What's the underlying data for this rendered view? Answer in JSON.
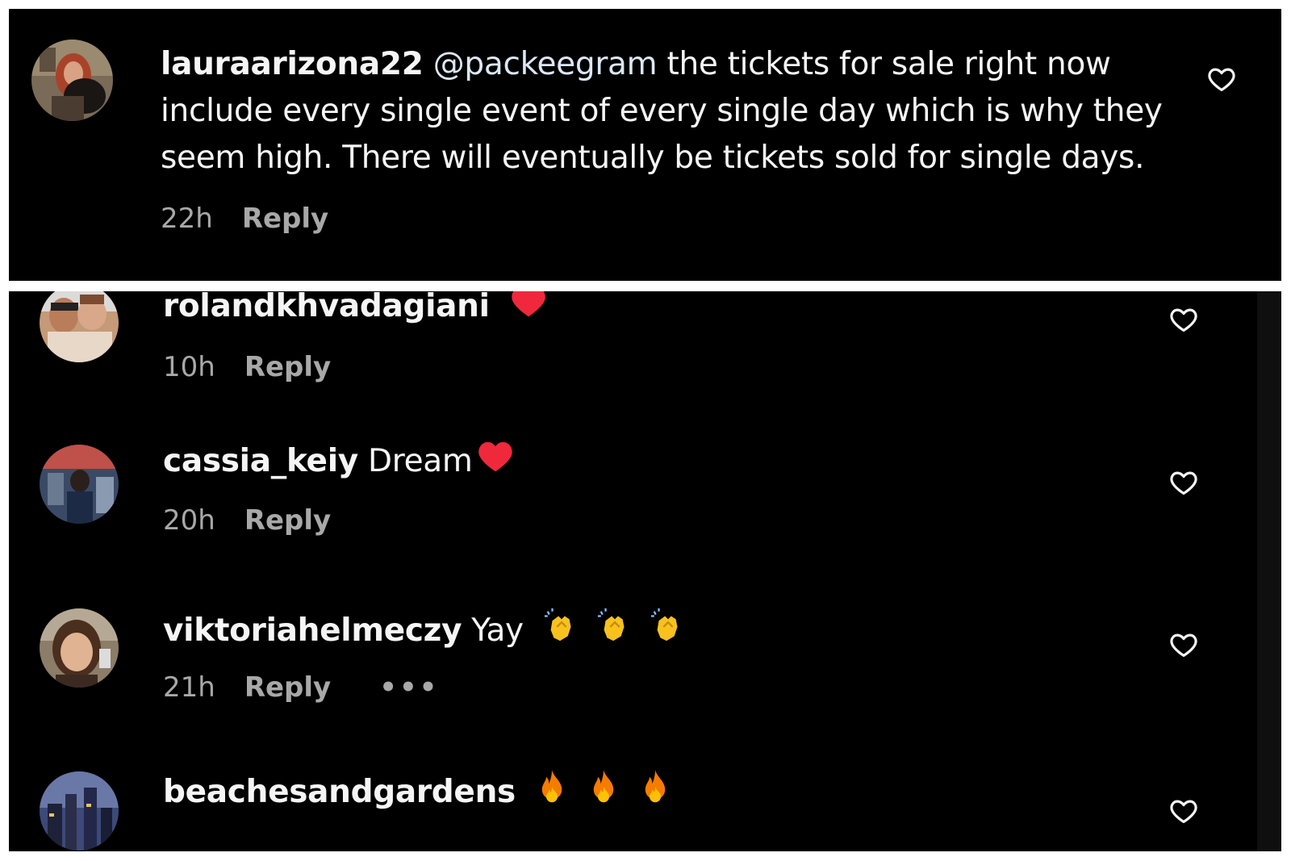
{
  "comments_top": [
    {
      "username": "lauraarizona22",
      "mention": "@packeegram",
      "text_line1": " the tickets for sale right now",
      "text_line2": "include every single event of every single day which is why they",
      "text_line3": "seem high. There will eventually be tickets sold for single days.",
      "time": "22h",
      "reply_label": "Reply",
      "like_icon": "heart-outline-icon"
    }
  ],
  "comments_bottom": [
    {
      "username": "rolandkhvadagiani",
      "text": "",
      "emojis": [
        "red-heart-icon"
      ],
      "time": "10h",
      "reply_label": "Reply",
      "like_icon": "heart-outline-icon"
    },
    {
      "username": "cassia_keiy",
      "text": " Dream",
      "emojis": [
        "red-heart-icon"
      ],
      "time": "20h",
      "reply_label": "Reply",
      "like_icon": "heart-outline-icon"
    },
    {
      "username": "viktoriahelmeczy",
      "text": " Yay",
      "emojis": [
        "clapping-hands-icon",
        "clapping-hands-icon",
        "clapping-hands-icon"
      ],
      "time": "21h",
      "reply_label": "Reply",
      "more_label": "•••",
      "like_icon": "heart-outline-icon"
    },
    {
      "username": "beachesandgardens",
      "text": "",
      "emojis": [
        "fire-icon",
        "fire-icon",
        "fire-icon"
      ],
      "like_icon": "heart-outline-icon"
    }
  ],
  "colors": {
    "background": "#000000",
    "text": "#f5f5f5",
    "meta": "#a8a8a8",
    "heart_red": "#f0283c",
    "clap_yellow": "#f7c21e",
    "fire_orange": "#f57c00"
  }
}
